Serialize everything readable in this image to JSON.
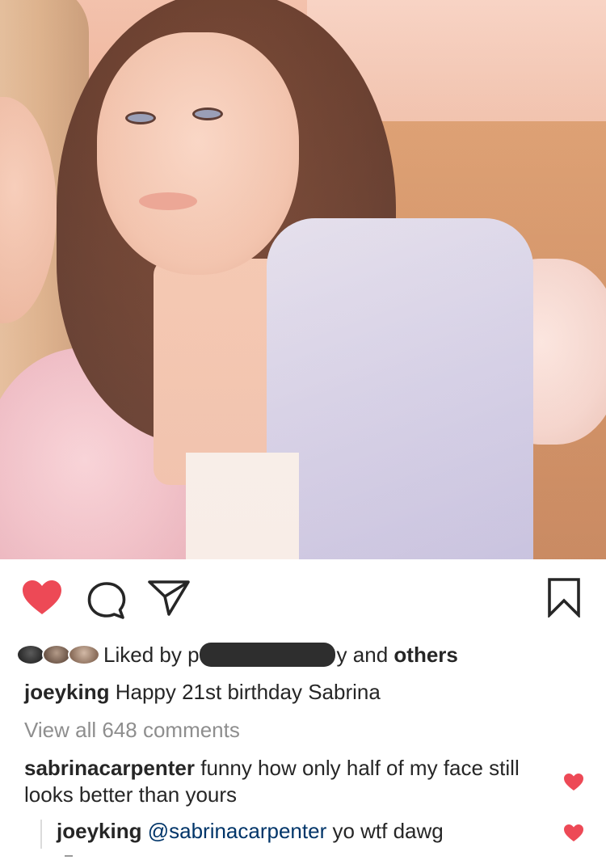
{
  "post": {
    "image_alt": "Two young women posing together, one in a lavender robe",
    "like_color": "#ed4956"
  },
  "action_bar": {
    "icons": [
      "heart-icon",
      "comment-icon",
      "share-icon",
      "bookmark-icon"
    ]
  },
  "likes": {
    "prefix": "Liked by",
    "redacted_first_char": "p",
    "redacted_last_char": "y",
    "connector": "and",
    "others_label": "others"
  },
  "caption": {
    "username": "joeyking",
    "text": "Happy 21st birthday Sabrina"
  },
  "comments_link": {
    "label": "View all 648 comments"
  },
  "comments": [
    {
      "username": "sabrinacarpenter",
      "text": "funny how only half of my face still looks better than yours",
      "liked": true
    }
  ],
  "replies": [
    {
      "username": "joeyking",
      "mention": "@sabrinacarpenter",
      "text": "yo wtf dawg",
      "liked": true
    }
  ]
}
